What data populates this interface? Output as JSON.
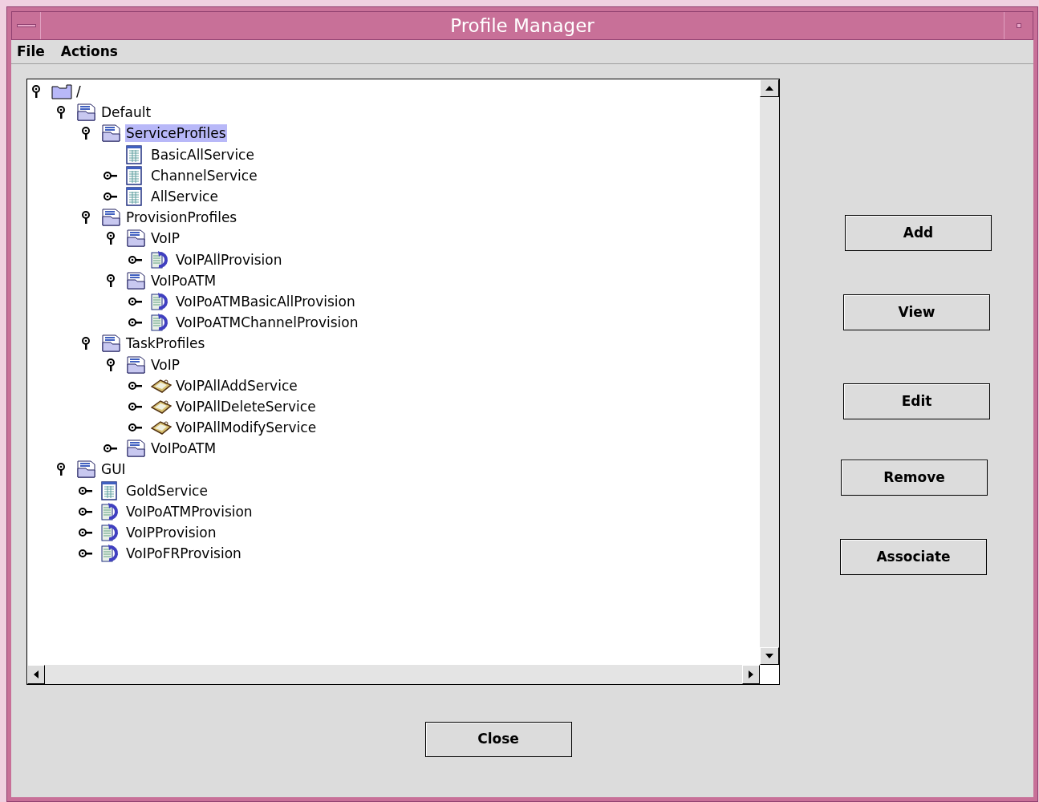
{
  "window": {
    "title": "Profile Manager"
  },
  "menu": [
    "File",
    "Actions"
  ],
  "tree": [
    {
      "label": "/",
      "kind": "root",
      "expanded": true,
      "selected": false,
      "children": [
        {
          "label": "Default",
          "kind": "folder",
          "expanded": true,
          "selected": false,
          "children": [
            {
              "label": "ServiceProfiles",
              "kind": "folder",
              "expanded": true,
              "selected": true,
              "children": [
                {
                  "label": "BasicAllService",
                  "kind": "service",
                  "selected": false
                },
                {
                  "label": "ChannelService",
                  "kind": "service",
                  "expanded": false,
                  "selected": false
                },
                {
                  "label": "AllService",
                  "kind": "service",
                  "expanded": false,
                  "selected": false
                }
              ]
            },
            {
              "label": "ProvisionProfiles",
              "kind": "folder",
              "expanded": true,
              "selected": false,
              "children": [
                {
                  "label": "VoIP",
                  "kind": "folder",
                  "expanded": true,
                  "selected": false,
                  "children": [
                    {
                      "label": "VoIPAllProvision",
                      "kind": "provision",
                      "expanded": false,
                      "selected": false
                    }
                  ]
                },
                {
                  "label": "VoIPoATM",
                  "kind": "folder",
                  "expanded": true,
                  "selected": false,
                  "children": [
                    {
                      "label": "VoIPoATMBasicAllProvision",
                      "kind": "provision",
                      "expanded": false,
                      "selected": false
                    },
                    {
                      "label": "VoIPoATMChannelProvision",
                      "kind": "provision",
                      "expanded": false,
                      "selected": false
                    }
                  ]
                }
              ]
            },
            {
              "label": "TaskProfiles",
              "kind": "folder",
              "expanded": true,
              "selected": false,
              "children": [
                {
                  "label": "VoIP",
                  "kind": "folder",
                  "expanded": true,
                  "selected": false,
                  "children": [
                    {
                      "label": "VoIPAllAddService",
                      "kind": "task",
                      "expanded": false,
                      "selected": false
                    },
                    {
                      "label": "VoIPAllDeleteService",
                      "kind": "task",
                      "expanded": false,
                      "selected": false
                    },
                    {
                      "label": "VoIPAllModifyService",
                      "kind": "task",
                      "expanded": false,
                      "selected": false
                    }
                  ]
                },
                {
                  "label": "VoIPoATM",
                  "kind": "folder",
                  "expanded": false,
                  "selected": false
                }
              ]
            }
          ]
        },
        {
          "label": "GUI",
          "kind": "folder",
          "expanded": true,
          "selected": false,
          "children": [
            {
              "label": "GoldService",
              "kind": "service",
              "expanded": false,
              "selected": false
            },
            {
              "label": "VoIPoATMProvision",
              "kind": "provision",
              "expanded": false,
              "selected": false
            },
            {
              "label": "VoIPProvision",
              "kind": "provision",
              "expanded": false,
              "selected": false
            },
            {
              "label": "VoIPoFRProvision",
              "kind": "provision",
              "expanded": false,
              "selected": false
            }
          ]
        }
      ]
    }
  ],
  "side_buttons": [
    "Add",
    "View",
    "Edit",
    "Remove",
    "Associate"
  ],
  "close_button": "Close"
}
